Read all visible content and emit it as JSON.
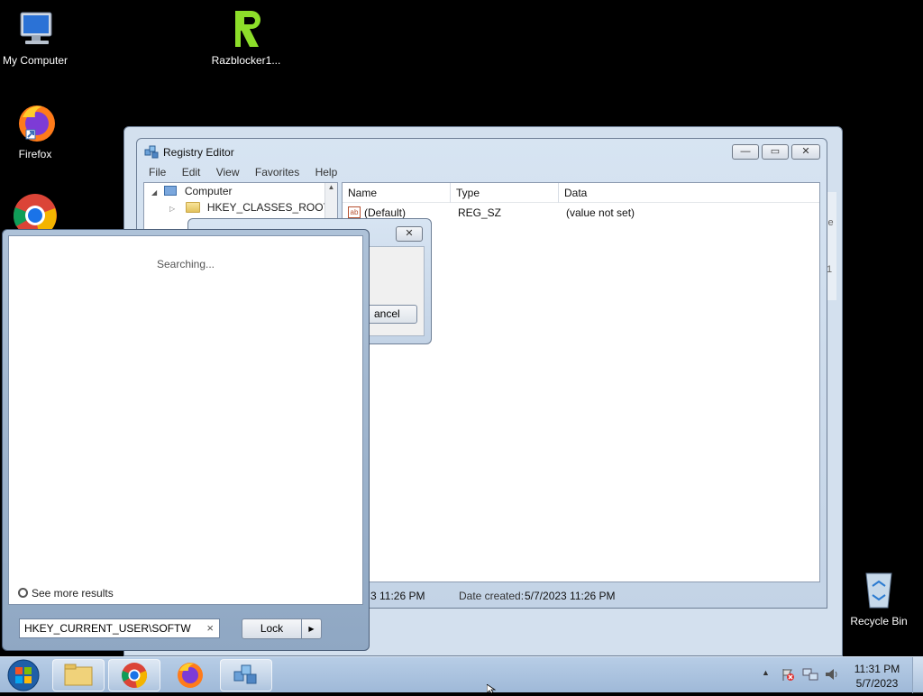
{
  "desktop": {
    "icons": [
      {
        "label": "My Computer"
      },
      {
        "label": "Razblocker1..."
      },
      {
        "label": "Firefox"
      },
      {
        "label": "Recycle Bin"
      }
    ]
  },
  "registry": {
    "title": "Registry Editor",
    "menu": [
      "File",
      "Edit",
      "View",
      "Favorites",
      "Help"
    ],
    "tree": {
      "root": "Computer",
      "items": [
        "HKEY_CLASSES_ROOT"
      ]
    },
    "columns": [
      "Name",
      "Type",
      "Data"
    ],
    "rows": [
      {
        "name": "(Default)",
        "type": "REG_SZ",
        "data": "(value not set)",
        "icon": "ab"
      }
    ],
    "status_left": "3 11:26 PM",
    "status_created_label": "Date created:",
    "status_created_value": "5/7/2023 11:26 PM",
    "back_window_fragments": [
      "ze",
      "1"
    ]
  },
  "find_dialog": {
    "cancel_label": "ancel"
  },
  "start_menu": {
    "searching_text": "Searching...",
    "see_more": "See more results",
    "search_value": "HKEY_CURRENT_USER\\SOFTW",
    "clear_glyph": "×",
    "lock_label": "Lock",
    "lock_arrow": "▶"
  },
  "taskbar": {
    "time": "11:31 PM",
    "date": "5/7/2023",
    "tray_arrow": "▲"
  },
  "colors": {
    "accent": "#1f5fa8",
    "chrome_red": "#db4437",
    "chrome_green": "#0f9d58",
    "chrome_yellow": "#f4b400",
    "razblocker_green": "#8dde2a"
  }
}
